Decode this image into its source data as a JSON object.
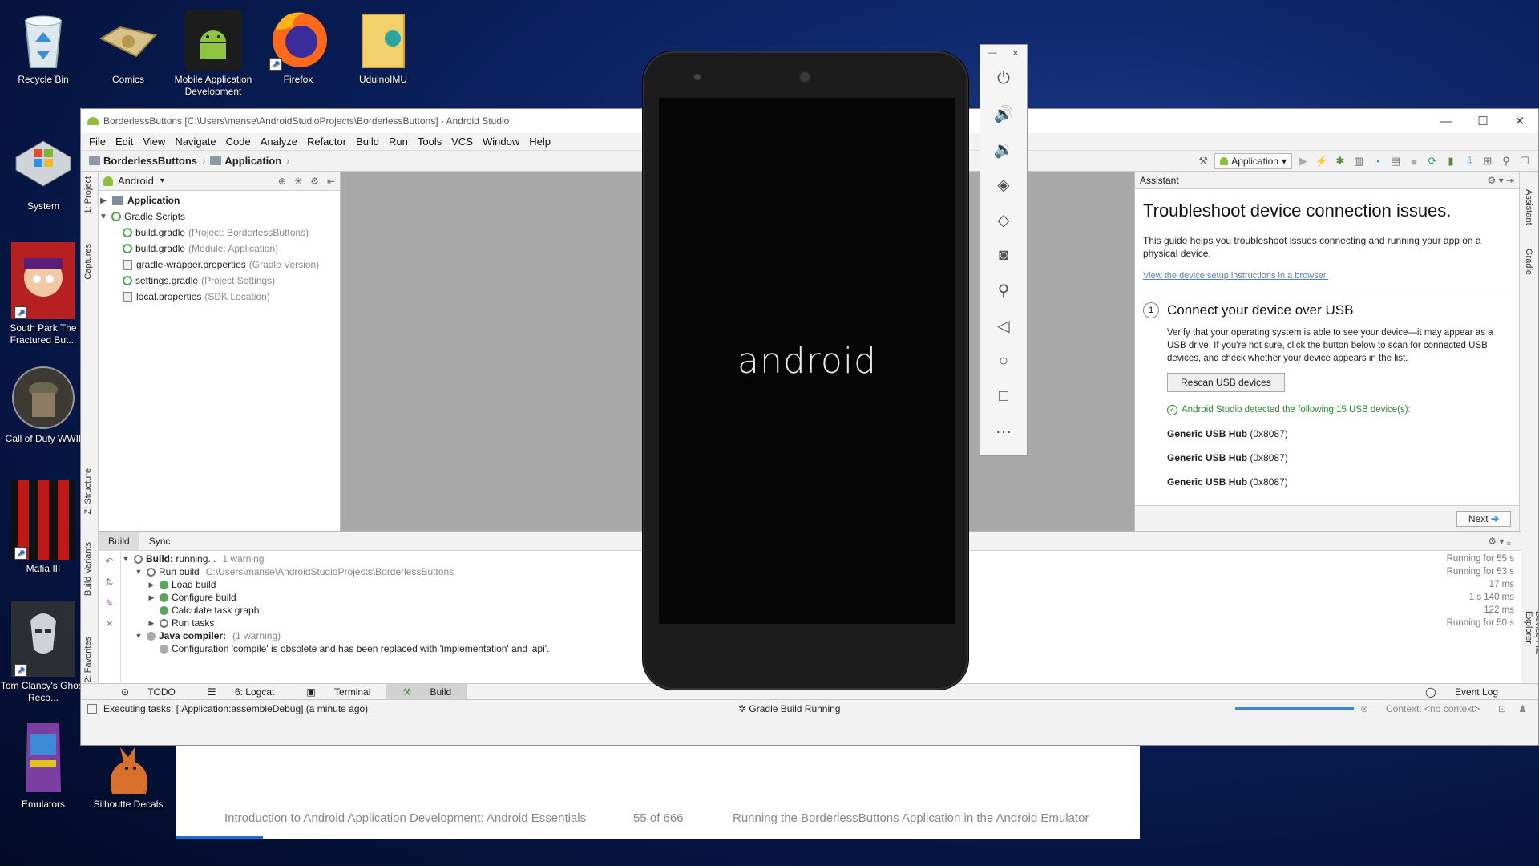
{
  "desktop": {
    "icons": [
      {
        "label": "Recycle Bin"
      },
      {
        "label": "Comics"
      },
      {
        "label": "Mobile Application Development"
      },
      {
        "label": "Firefox"
      },
      {
        "label": "UduinoIMU"
      },
      {
        "label": "System"
      },
      {
        "label": "South Park The Fractured But..."
      },
      {
        "label": "Call of Duty WWII"
      },
      {
        "label": "Mafia III"
      },
      {
        "label": "Tom Clancy's Ghost Reco..."
      },
      {
        "label": "Emulators"
      },
      {
        "label": "Silhoutte Decals"
      }
    ]
  },
  "studio": {
    "title": "BorderlessButtons [C:\\Users\\manse\\AndroidStudioProjects\\BorderlessButtons] - Android Studio",
    "menu": [
      "File",
      "Edit",
      "View",
      "Navigate",
      "Code",
      "Analyze",
      "Refactor",
      "Build",
      "Run",
      "Tools",
      "VCS",
      "Window",
      "Help"
    ],
    "breadcrumb": [
      "BorderlessButtons",
      "Application"
    ],
    "run_config": "Application",
    "left_tabs": [
      "1: Project",
      "Captures",
      "Z: Structure",
      "Build Variants",
      "2: Favorites"
    ],
    "right_tabs": [
      "Assistant",
      "Gradle",
      "Device File Explorer"
    ],
    "project": {
      "view": "Android",
      "tree": [
        {
          "name": "Application",
          "hint": "",
          "level": 0,
          "bold": true
        },
        {
          "name": "Gradle Scripts",
          "hint": "",
          "level": 0,
          "bold": false
        },
        {
          "name": "build.gradle",
          "hint": "(Project: BorderlessButtons)",
          "level": 1,
          "bold": false
        },
        {
          "name": "build.gradle",
          "hint": "(Module: Application)",
          "level": 1,
          "bold": false
        },
        {
          "name": "gradle-wrapper.properties",
          "hint": "(Gradle Version)",
          "level": 1,
          "bold": false
        },
        {
          "name": "settings.gradle",
          "hint": "(Project Settings)",
          "level": 1,
          "bold": false
        },
        {
          "name": "local.properties",
          "hint": "(SDK Location)",
          "level": 1,
          "bold": false
        }
      ]
    },
    "assistant": {
      "header": "Assistant",
      "title": "Troubleshoot device connection issues.",
      "intro": "This guide helps you troubleshoot issues connecting and running your app on a physical device.",
      "link": "View the device setup instructions in a browser.",
      "step_num": "1",
      "step_title": "Connect your device over USB",
      "step_text": "Verify that your operating system is able to see your device—it may appear as a USB drive. If you're not sure, click the button below to scan for connected USB devices, and check whether your device appears in the list.",
      "rescan": "Rescan USB devices",
      "detected": "Android Studio detected the following 15 USB device(s):",
      "devices": [
        {
          "name": "Generic USB Hub",
          "id": "(0x8087)"
        },
        {
          "name": "Generic USB Hub",
          "id": "(0x8087)"
        },
        {
          "name": "Generic USB Hub",
          "id": "(0x8087)"
        }
      ],
      "next": "Next"
    },
    "build": {
      "tabs": [
        "Build",
        "Sync"
      ],
      "lines": [
        {
          "text": "Build:",
          "extra": "running...",
          "gray": "1 warning",
          "time": "Running for 55 s"
        },
        {
          "text": "Run build",
          "extra": "",
          "gray": "C:\\Users\\manse\\AndroidStudioProjects\\BorderlessButtons",
          "time": "Running for 53 s"
        },
        {
          "text": "Load build",
          "extra": "",
          "gray": "",
          "time": "17 ms"
        },
        {
          "text": "Configure build",
          "extra": "",
          "gray": "",
          "time": "1 s 140 ms"
        },
        {
          "text": "Calculate task graph",
          "extra": "",
          "gray": "",
          "time": "122 ms"
        },
        {
          "text": "Run tasks",
          "extra": "",
          "gray": "",
          "time": "Running for 50 s"
        },
        {
          "text": "Java compiler:",
          "extra": "",
          "gray": "(1 warning)",
          "time": ""
        },
        {
          "text": "Configuration 'compile' is obsolete and has been replaced with 'implementation' and 'api'.",
          "extra": "",
          "gray": "",
          "time": ""
        }
      ]
    },
    "bottom_tabs": [
      "TODO",
      "6: Logcat",
      "Terminal",
      "Build"
    ],
    "event_log": "Event Log",
    "status": {
      "left": "Executing tasks: [:Application:assembleDebug] (a minute ago)",
      "mid": "Gradle Build Running",
      "context": "Context: <no context>"
    }
  },
  "emulator": {
    "screen_text": "android"
  },
  "reader": {
    "book": "Introduction to Android Application Development: Android Essentials",
    "page": "55 of 666",
    "chapter": "Running the BorderlessButtons Application in the Android Emulator"
  }
}
